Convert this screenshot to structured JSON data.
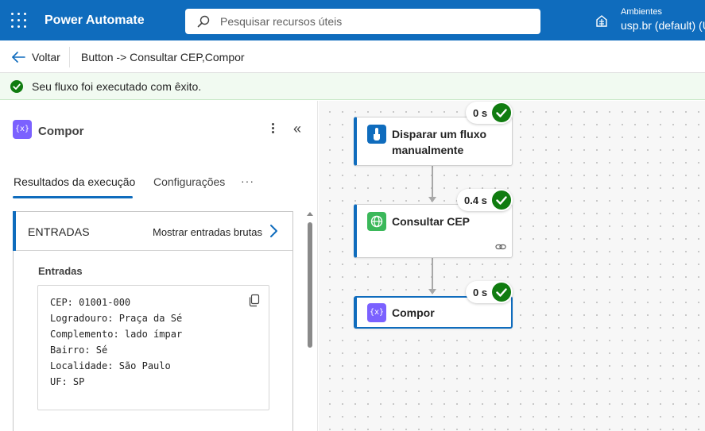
{
  "app": {
    "title": "Power Automate"
  },
  "search": {
    "placeholder": "Pesquisar recursos úteis"
  },
  "environment": {
    "label": "Ambientes",
    "value": "usp.br (default) (U"
  },
  "breadcrumb": {
    "back_label": "Voltar",
    "flow_title": "Button -> Consultar CEP,Compor"
  },
  "banner": {
    "text": "Seu fluxo foi executado com êxito."
  },
  "panel": {
    "title": "Compor",
    "tabs": [
      {
        "label": "Resultados da execução",
        "selected": true
      },
      {
        "label": "Configurações",
        "selected": false
      }
    ],
    "more_label": "···",
    "inputs_card": {
      "header": "ENTRADAS",
      "raw_link": "Mostrar entradas brutas",
      "section_label": "Entradas",
      "lines": [
        "CEP: 01001-000",
        "Logradouro: Praça da Sé",
        "Complemento: lado ímpar",
        "Bairro: Sé",
        "Localidade: São Paulo",
        "UF: SP"
      ]
    }
  },
  "flow": {
    "nodes": [
      {
        "label_line1": "Disparar um fluxo",
        "label_line2": "manualmente",
        "duration": "0 s",
        "status": "succeeded",
        "icon": "manual-trigger-icon",
        "icon_color": "#0f6cbd"
      },
      {
        "label": "Consultar CEP",
        "duration": "0.4 s",
        "status": "succeeded",
        "icon": "http-globe-icon",
        "icon_color": "#3bb85a"
      },
      {
        "label": "Compor",
        "duration": "0 s",
        "status": "succeeded",
        "icon": "compose-icon",
        "icon_color": "#7b61ff",
        "selected": true
      }
    ]
  },
  "colors": {
    "brand": "#0f6cbd",
    "success": "#107c10",
    "banner_bg": "#f1faf1"
  }
}
